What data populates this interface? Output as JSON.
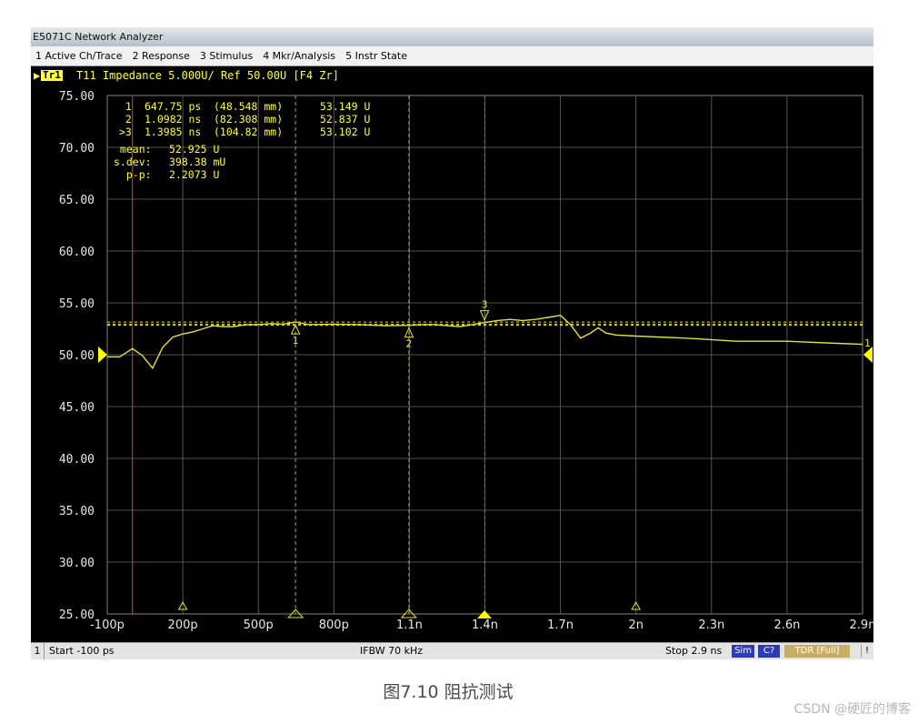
{
  "window": {
    "title": "E5071C Network Analyzer"
  },
  "menu": [
    "1 Active Ch/Trace",
    "2 Response",
    "3 Stimulus",
    "4 Mkr/Analysis",
    "5 Instr State"
  ],
  "trace_bar": {
    "badge": "Tr1",
    "info": "T11 Impedance 5.000U/ Ref 50.00U [F4 Zr]"
  },
  "markers": [
    {
      "label": " 1",
      "time": "647.75 ps",
      "dist": "(48.548 mm)",
      "value": "53.149 U"
    },
    {
      "label": " 2",
      "time": "1.0982 ns",
      "dist": "(82.308 mm)",
      "value": "52.837 U"
    },
    {
      "label": ">3",
      "time": "1.3985 ns",
      "dist": "(104.82 mm)",
      "value": "53.102 U"
    }
  ],
  "stats": [
    {
      "label": " mean:",
      "value": "52.925 U"
    },
    {
      "label": "s.dev:",
      "value": "398.38 mU"
    },
    {
      "label": "  p-p:",
      "value": "2.2073 U"
    }
  ],
  "chart_data": {
    "type": "line",
    "title": "T11 Impedance 5.000U/ Ref 50.00U [F4 Zr]",
    "xlabel": "",
    "ylabel": "",
    "xlim": [
      -0.1,
      2.9
    ],
    "ylim": [
      25,
      75
    ],
    "x_unit": "ns",
    "y_unit": "U",
    "y_ticks": [
      "75.00",
      "70.00",
      "65.00",
      "60.00",
      "55.00",
      "50.00",
      "45.00",
      "40.00",
      "35.00",
      "30.00",
      "25.00"
    ],
    "x_ticks": [
      "-100p",
      "200p",
      "500p",
      "800p",
      "1.1n",
      "1.4n",
      "1.7n",
      "2n",
      "2.3n",
      "2.6n",
      "2.9n"
    ],
    "grid": true,
    "reference_level": 50.0,
    "stat_lines": [
      53.149,
      52.925,
      52.837
    ],
    "line_color": "#e6e03a",
    "series": [
      {
        "x": [
          -0.1,
          -0.05,
          0.0,
          0.04,
          0.08,
          0.12,
          0.16,
          0.2,
          0.24,
          0.28,
          0.32,
          0.36,
          0.4,
          0.45,
          0.5,
          0.55,
          0.6,
          0.648,
          0.7,
          0.8,
          0.9,
          1.0,
          1.098,
          1.15,
          1.2,
          1.3,
          1.35,
          1.399,
          1.45,
          1.5,
          1.55,
          1.6,
          1.65,
          1.7,
          1.74,
          1.78,
          1.82,
          1.85,
          1.88,
          1.92,
          2.0,
          2.2,
          2.4,
          2.6,
          2.8,
          2.9
        ],
        "y": [
          49.8,
          49.8,
          50.6,
          49.9,
          48.7,
          50.7,
          51.7,
          52.0,
          52.2,
          52.5,
          52.8,
          52.7,
          52.7,
          52.9,
          52.9,
          53.0,
          52.95,
          53.149,
          52.9,
          52.95,
          52.9,
          52.8,
          52.837,
          52.9,
          52.9,
          52.7,
          52.9,
          53.102,
          53.3,
          53.4,
          53.3,
          53.4,
          53.6,
          53.8,
          52.9,
          51.6,
          52.1,
          52.6,
          52.1,
          51.9,
          51.8,
          51.6,
          51.3,
          51.3,
          51.1,
          51.0
        ]
      }
    ],
    "markers": [
      {
        "id": "1",
        "x": 0.64775,
        "y": 53.149,
        "active": false
      },
      {
        "id": "2",
        "x": 1.0982,
        "y": 52.837,
        "active": false
      },
      {
        "id": "3",
        "x": 1.3985,
        "y": 53.102,
        "active": true
      }
    ],
    "bottom_marker_positions": [
      0.2,
      0.648,
      1.098,
      1.3985,
      2.0
    ],
    "red_line_x": 0.0
  },
  "status": {
    "ch": "1",
    "start": "Start -100 ps",
    "ifbw": "IFBW 70 kHz",
    "stop": "Stop 2.9 ns",
    "sim": "Sim",
    "cal": "C?",
    "tdr": "TDR [Full]",
    "bang": "!"
  },
  "caption": "图7.10 阻抗测试",
  "watermark": "CSDN @硬匠的博客"
}
